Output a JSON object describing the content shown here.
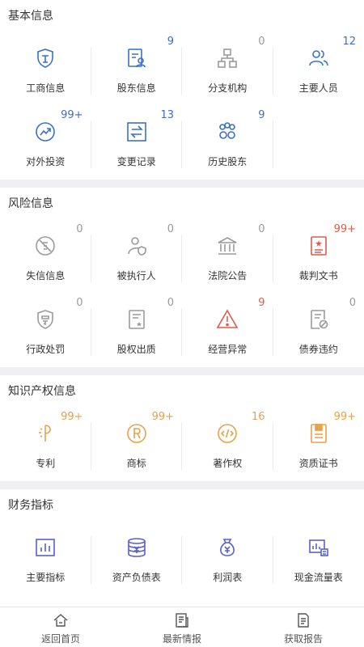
{
  "colors": {
    "blue": "#3b6fc9",
    "gray": "#9a9a9a",
    "red": "#e05a4e",
    "orange": "#eaa14a"
  },
  "sections": {
    "basic": {
      "title": "基本信息",
      "items": [
        {
          "label": "工商信息",
          "count": "",
          "icon": "shield-icon"
        },
        {
          "label": "股东信息",
          "count": "9",
          "icon": "shareholder-doc-icon"
        },
        {
          "label": "分支机构",
          "count": "0",
          "icon": "org-tree-icon"
        },
        {
          "label": "主要人员",
          "count": "12",
          "icon": "people-icon"
        },
        {
          "label": "对外投资",
          "count": "99+",
          "icon": "trend-circle-icon"
        },
        {
          "label": "变更记录",
          "count": "13",
          "icon": "exchange-icon"
        },
        {
          "label": "历史股东",
          "count": "9",
          "icon": "group-icon"
        }
      ]
    },
    "risk": {
      "title": "风险信息",
      "items": [
        {
          "label": "失信信息",
          "count": "0",
          "icon": "no-credit-icon"
        },
        {
          "label": "被执行人",
          "count": "0",
          "icon": "person-shield-icon"
        },
        {
          "label": "法院公告",
          "count": "0",
          "icon": "court-icon"
        },
        {
          "label": "裁判文书",
          "count": "99+",
          "icon": "judgment-doc-icon"
        },
        {
          "label": "行政处罚",
          "count": "0",
          "icon": "penalty-shield-icon"
        },
        {
          "label": "股权出质",
          "count": "0",
          "icon": "equity-doc-icon"
        },
        {
          "label": "经营异常",
          "count": "9",
          "icon": "warning-icon"
        },
        {
          "label": "债券违约",
          "count": "0",
          "icon": "bond-default-icon"
        }
      ]
    },
    "ip": {
      "title": "知识产权信息",
      "items": [
        {
          "label": "专利",
          "count": "99+",
          "icon": "patent-icon"
        },
        {
          "label": "商标",
          "count": "99+",
          "icon": "trademark-icon"
        },
        {
          "label": "著作权",
          "count": "16",
          "icon": "copyright-code-icon"
        },
        {
          "label": "资质证书",
          "count": "99+",
          "icon": "certificate-icon"
        }
      ]
    },
    "finance": {
      "title": "财务指标",
      "items": [
        {
          "label": "主要指标",
          "count": "",
          "icon": "bar-chart-icon"
        },
        {
          "label": "资产负债表",
          "count": "",
          "icon": "coin-stack-icon"
        },
        {
          "label": "利润表",
          "count": "",
          "icon": "money-bag-icon"
        },
        {
          "label": "现金流量表",
          "count": "",
          "icon": "cash-flow-icon"
        }
      ]
    }
  },
  "bottom_nav": [
    {
      "label": "返回首页",
      "icon": "home-icon"
    },
    {
      "label": "最新情报",
      "icon": "news-icon"
    },
    {
      "label": "获取报告",
      "icon": "report-icon"
    }
  ]
}
